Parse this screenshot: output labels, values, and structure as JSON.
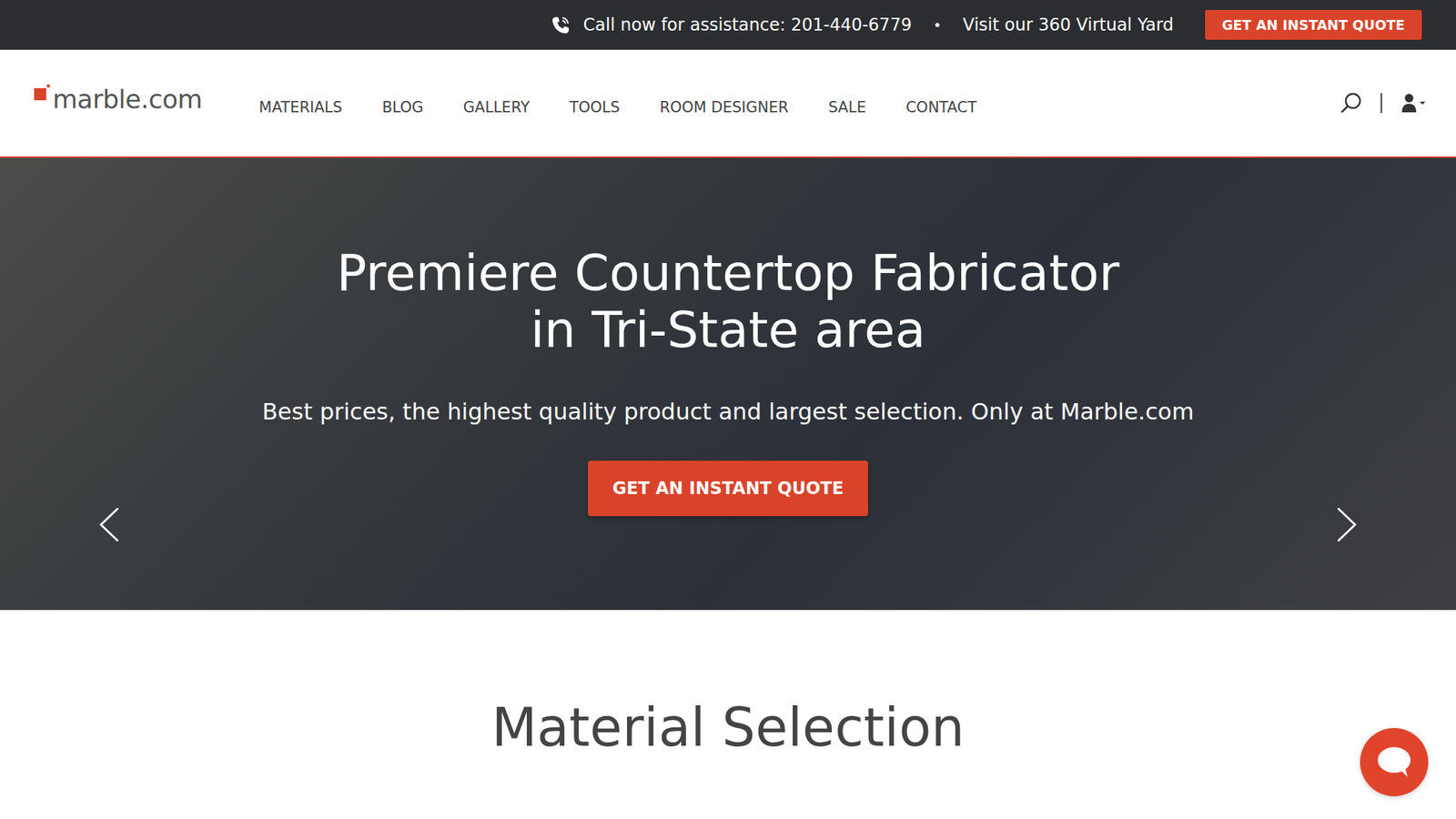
{
  "topbar": {
    "phone_text": "Call now for assistance: 201-440-6779",
    "separator": "•",
    "virtual_yard": "Visit our 360 Virtual Yard",
    "quote_button": "GET AN INSTANT QUOTE"
  },
  "logo": "marble.com",
  "nav": {
    "items": [
      "MATERIALS",
      "BLOG",
      "GALLERY",
      "TOOLS",
      "ROOM DESIGNER",
      "SALE",
      "CONTACT"
    ]
  },
  "hero": {
    "title_lines": [
      "Premiere Countertop Fabricator",
      "in Tri-State area"
    ],
    "subtitle": "Best prices, the highest quality product and largest selection. Only at Marble.com",
    "button": "GET AN INSTANT QUOTE"
  },
  "section": {
    "title": "Material Selection"
  }
}
